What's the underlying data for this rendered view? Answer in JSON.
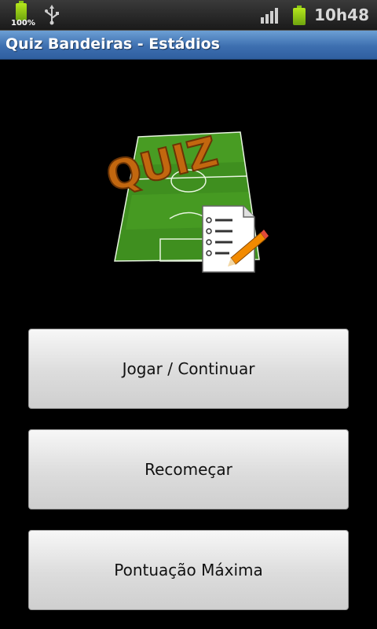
{
  "status_bar": {
    "battery_percent": "100%",
    "time": "10h48",
    "icons": [
      "battery-icon",
      "usb-icon",
      "signal-icon",
      "battery-icon"
    ]
  },
  "app": {
    "title": "Quiz Bandeiras - Estádios"
  },
  "logo": {
    "text": "QUIZ"
  },
  "menu": {
    "play_label": "Jogar / Continuar",
    "restart_label": "Recomeçar",
    "highscore_label": "Pontuação Máxima"
  },
  "colors": {
    "title_bar": "#3d6fb0",
    "background": "#000000",
    "button": "#dcdcdc",
    "field_green": "#3f8f1f",
    "logo_orange": "#c2670f"
  }
}
